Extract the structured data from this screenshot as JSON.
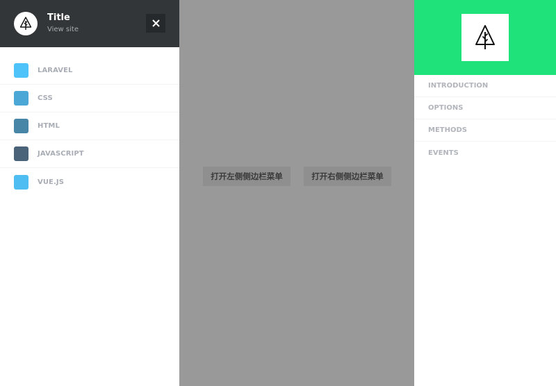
{
  "left_sidebar": {
    "title": "Title",
    "subtitle": "View site",
    "close_icon": "close-icon",
    "logo_icon": "tree-icon",
    "items": [
      {
        "label": "LARAVEL",
        "color": "#4dc3fa"
      },
      {
        "label": "CSS",
        "color": "#4ba7d6"
      },
      {
        "label": "HTML",
        "color": "#4886a8"
      },
      {
        "label": "JAVASCRIPT",
        "color": "#4a6378"
      },
      {
        "label": "VUE.JS",
        "color": "#4dbdf2"
      }
    ]
  },
  "main": {
    "open_left_label": "打开左侧侧边栏菜单",
    "open_right_label": "打开右侧侧边栏菜单"
  },
  "right_sidebar": {
    "header_color": "#1fe37a",
    "logo_icon": "tree-icon",
    "items": [
      {
        "label": "INTRODUCTION"
      },
      {
        "label": "OPTIONS"
      },
      {
        "label": "METHODS"
      },
      {
        "label": "EVENTS"
      }
    ]
  }
}
